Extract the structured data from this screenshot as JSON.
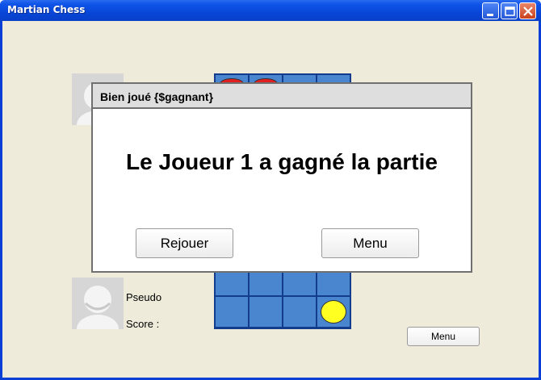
{
  "window": {
    "title": "Martian Chess",
    "controls": [
      "minimize-icon",
      "maximize-icon",
      "close-icon"
    ]
  },
  "player_bottom": {
    "pseudo_label": "Pseudo",
    "score_label": "Score :"
  },
  "board": {
    "rows": 8,
    "cols": 4,
    "pieces": [
      {
        "color": "#e02020",
        "row": 0,
        "col": 0
      },
      {
        "color": "#e02020",
        "row": 0,
        "col": 1
      },
      {
        "color": "#ffff22",
        "row": 7,
        "col": 3
      }
    ]
  },
  "menu_button": {
    "label": "Menu"
  },
  "dialog": {
    "title": "Bien joué {$gagnant}",
    "message": "Le Joueur 1 a gagné la partie",
    "replay_label": "Rejouer",
    "menu_label": "Menu"
  },
  "colors": {
    "titlebar": "#0846d8",
    "client_bg": "#eeebdb",
    "board_cell": "#4a86cf",
    "board_grid": "#143c8c"
  }
}
